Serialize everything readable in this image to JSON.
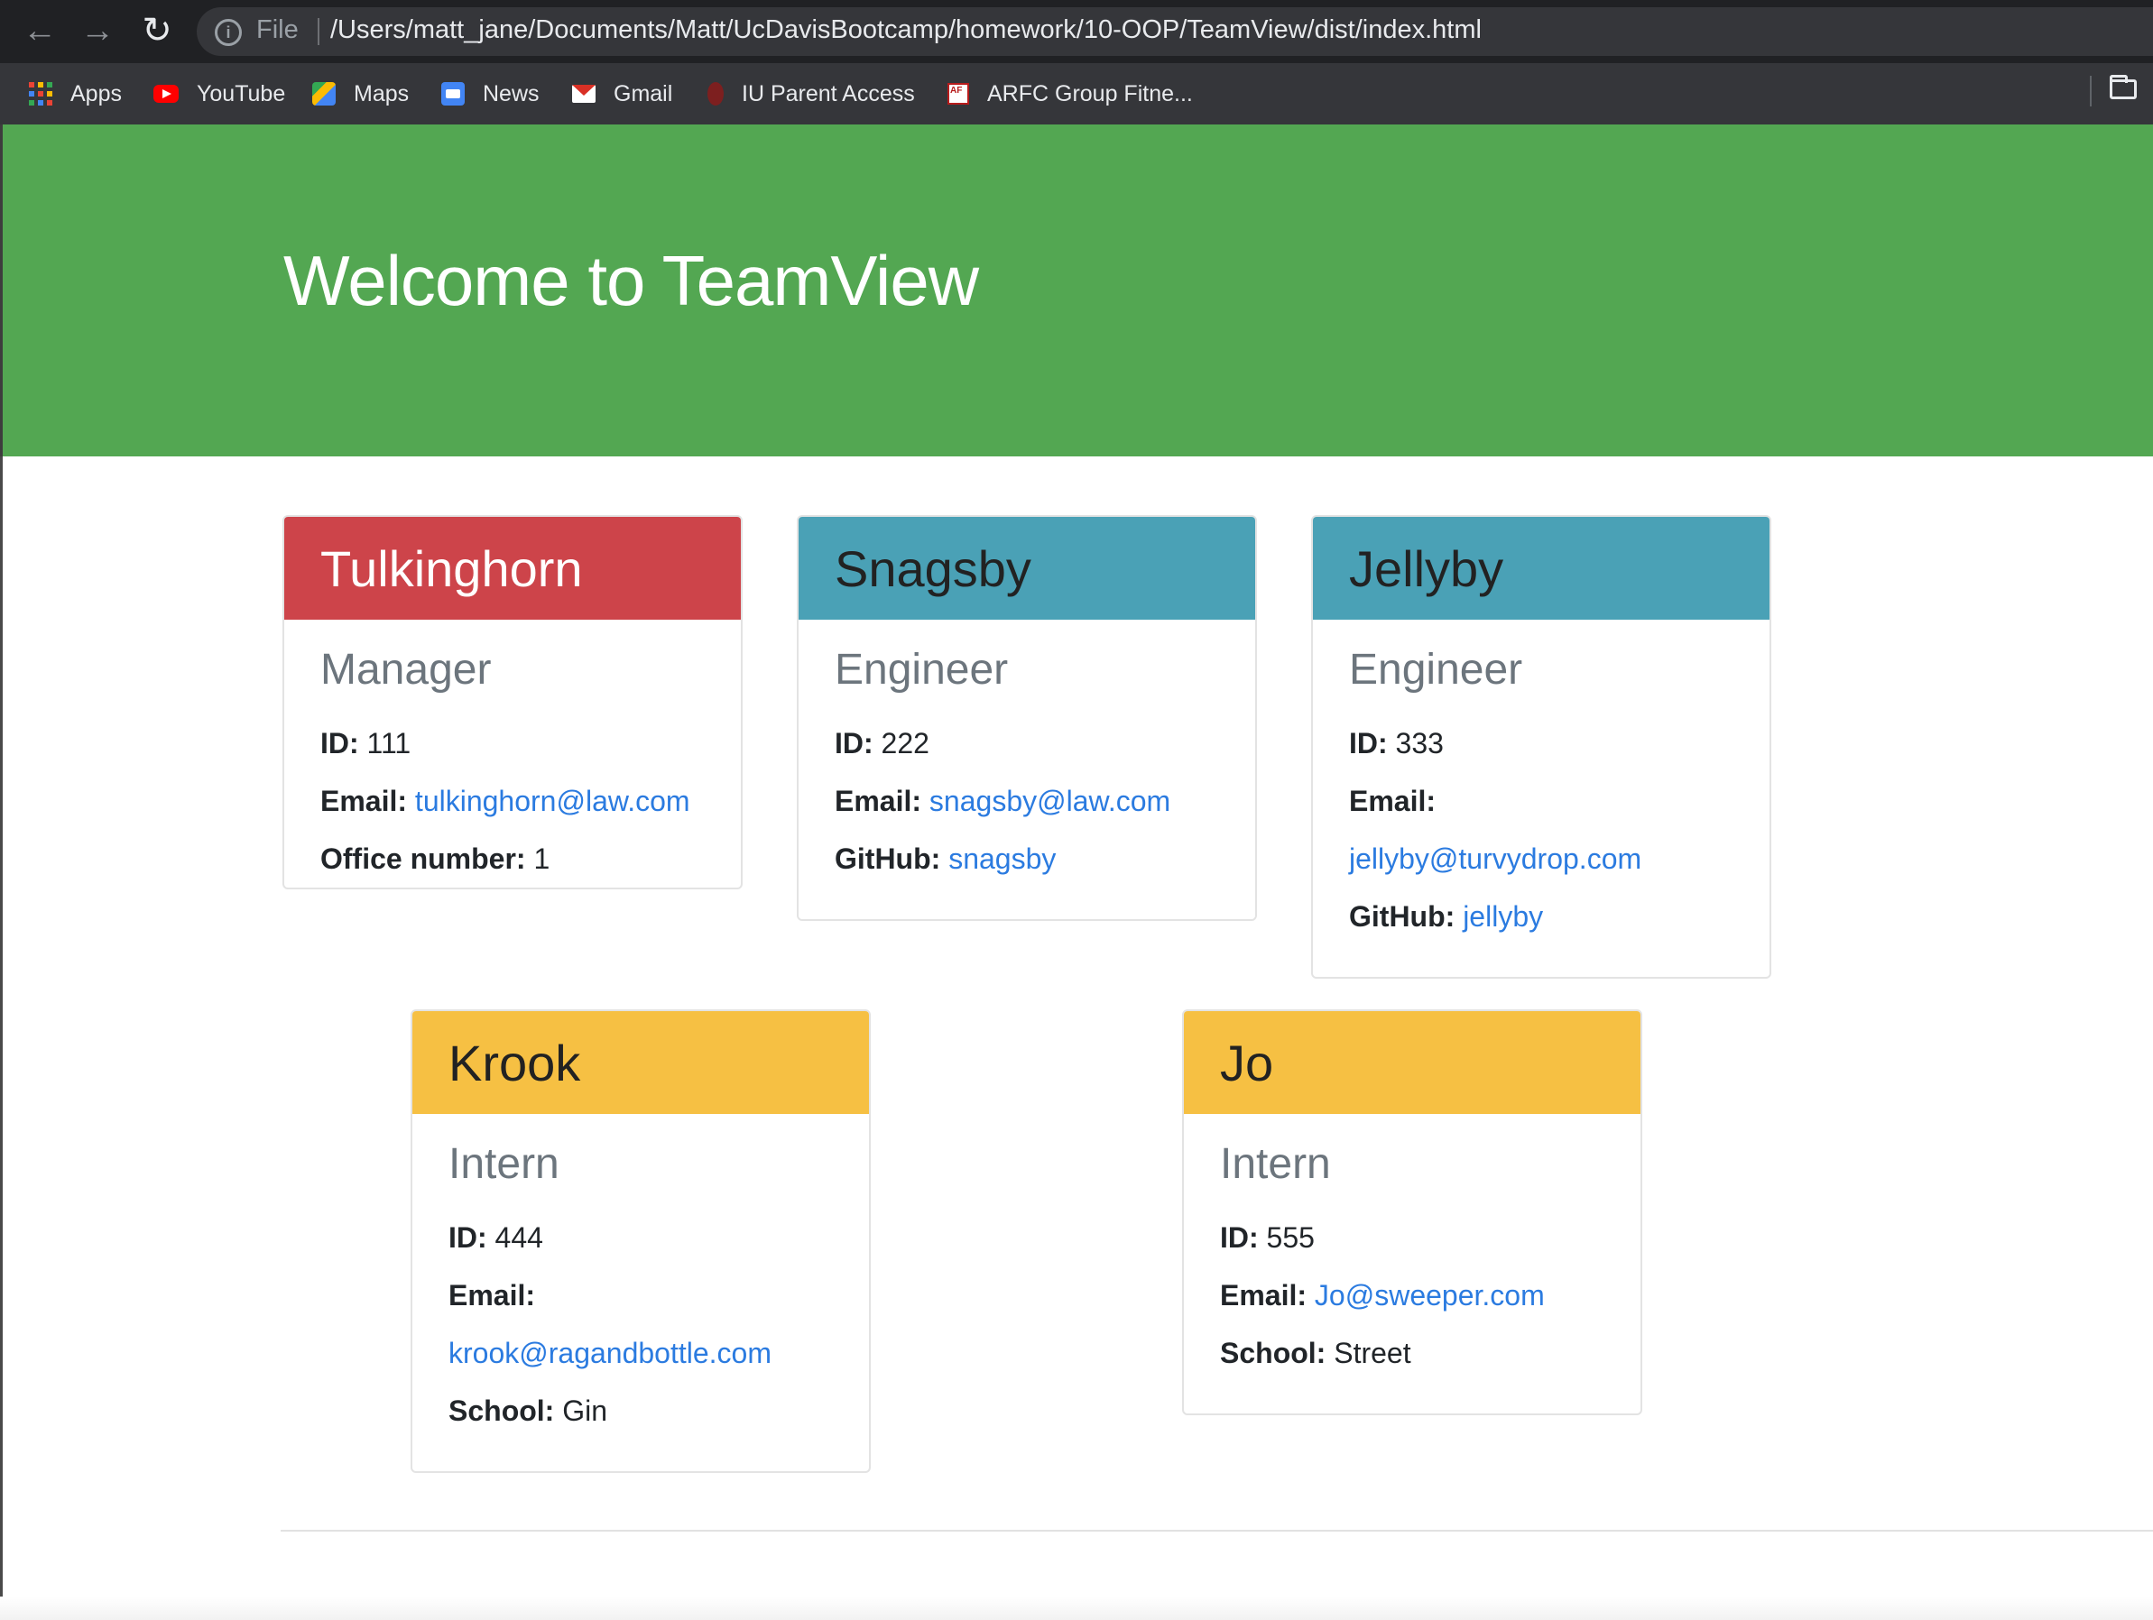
{
  "browser": {
    "file_label": "File",
    "url": "/Users/matt_jane/Documents/Matt/UcDavisBootcamp/homework/10-OOP/TeamView/dist/index.html",
    "bookmarks": [
      {
        "label": "Apps",
        "icon": "apps-grid-icon"
      },
      {
        "label": "YouTube",
        "icon": "youtube-icon"
      },
      {
        "label": "Maps",
        "icon": "maps-icon"
      },
      {
        "label": "News",
        "icon": "news-icon"
      },
      {
        "label": "Gmail",
        "icon": "gmail-icon"
      },
      {
        "label": "IU Parent Access",
        "icon": "iu-icon"
      },
      {
        "label": "ARFC Group Fitne...",
        "icon": "arfc-icon"
      }
    ]
  },
  "page": {
    "title": "Welcome to TeamView",
    "colors": {
      "jumbotron": "#53a752",
      "manager": "#cd444a",
      "engineer": "#4aa1b6",
      "intern": "#f6c043",
      "link": "#2b7be0"
    }
  },
  "team": [
    {
      "name": "Tulkinghorn",
      "role": "Manager",
      "id_label": "ID:",
      "id": "111",
      "email_label": "Email:",
      "email": "tulkinghorn@law.com",
      "extra_label": "Office number:",
      "extra": "1"
    },
    {
      "name": "Snagsby",
      "role": "Engineer",
      "id_label": "ID:",
      "id": "222",
      "email_label": "Email:",
      "email": "snagsby@law.com",
      "extra_label": "GitHub:",
      "extra": "snagsby"
    },
    {
      "name": "Jellyby",
      "role": "Engineer",
      "id_label": "ID:",
      "id": "333",
      "email_label": "Email:",
      "email": "jellyby@turvydrop.com",
      "extra_label": "GitHub:",
      "extra": "jellyby"
    },
    {
      "name": "Krook",
      "role": "Intern",
      "id_label": "ID:",
      "id": "444",
      "email_label": "Email:",
      "email": "krook@ragandbottle.com",
      "extra_label": "School:",
      "extra": "Gin"
    },
    {
      "name": "Jo",
      "role": "Intern",
      "id_label": "ID:",
      "id": "555",
      "email_label": "Email:",
      "email": "Jo@sweeper.com",
      "extra_label": "School:",
      "extra": "Street"
    }
  ]
}
